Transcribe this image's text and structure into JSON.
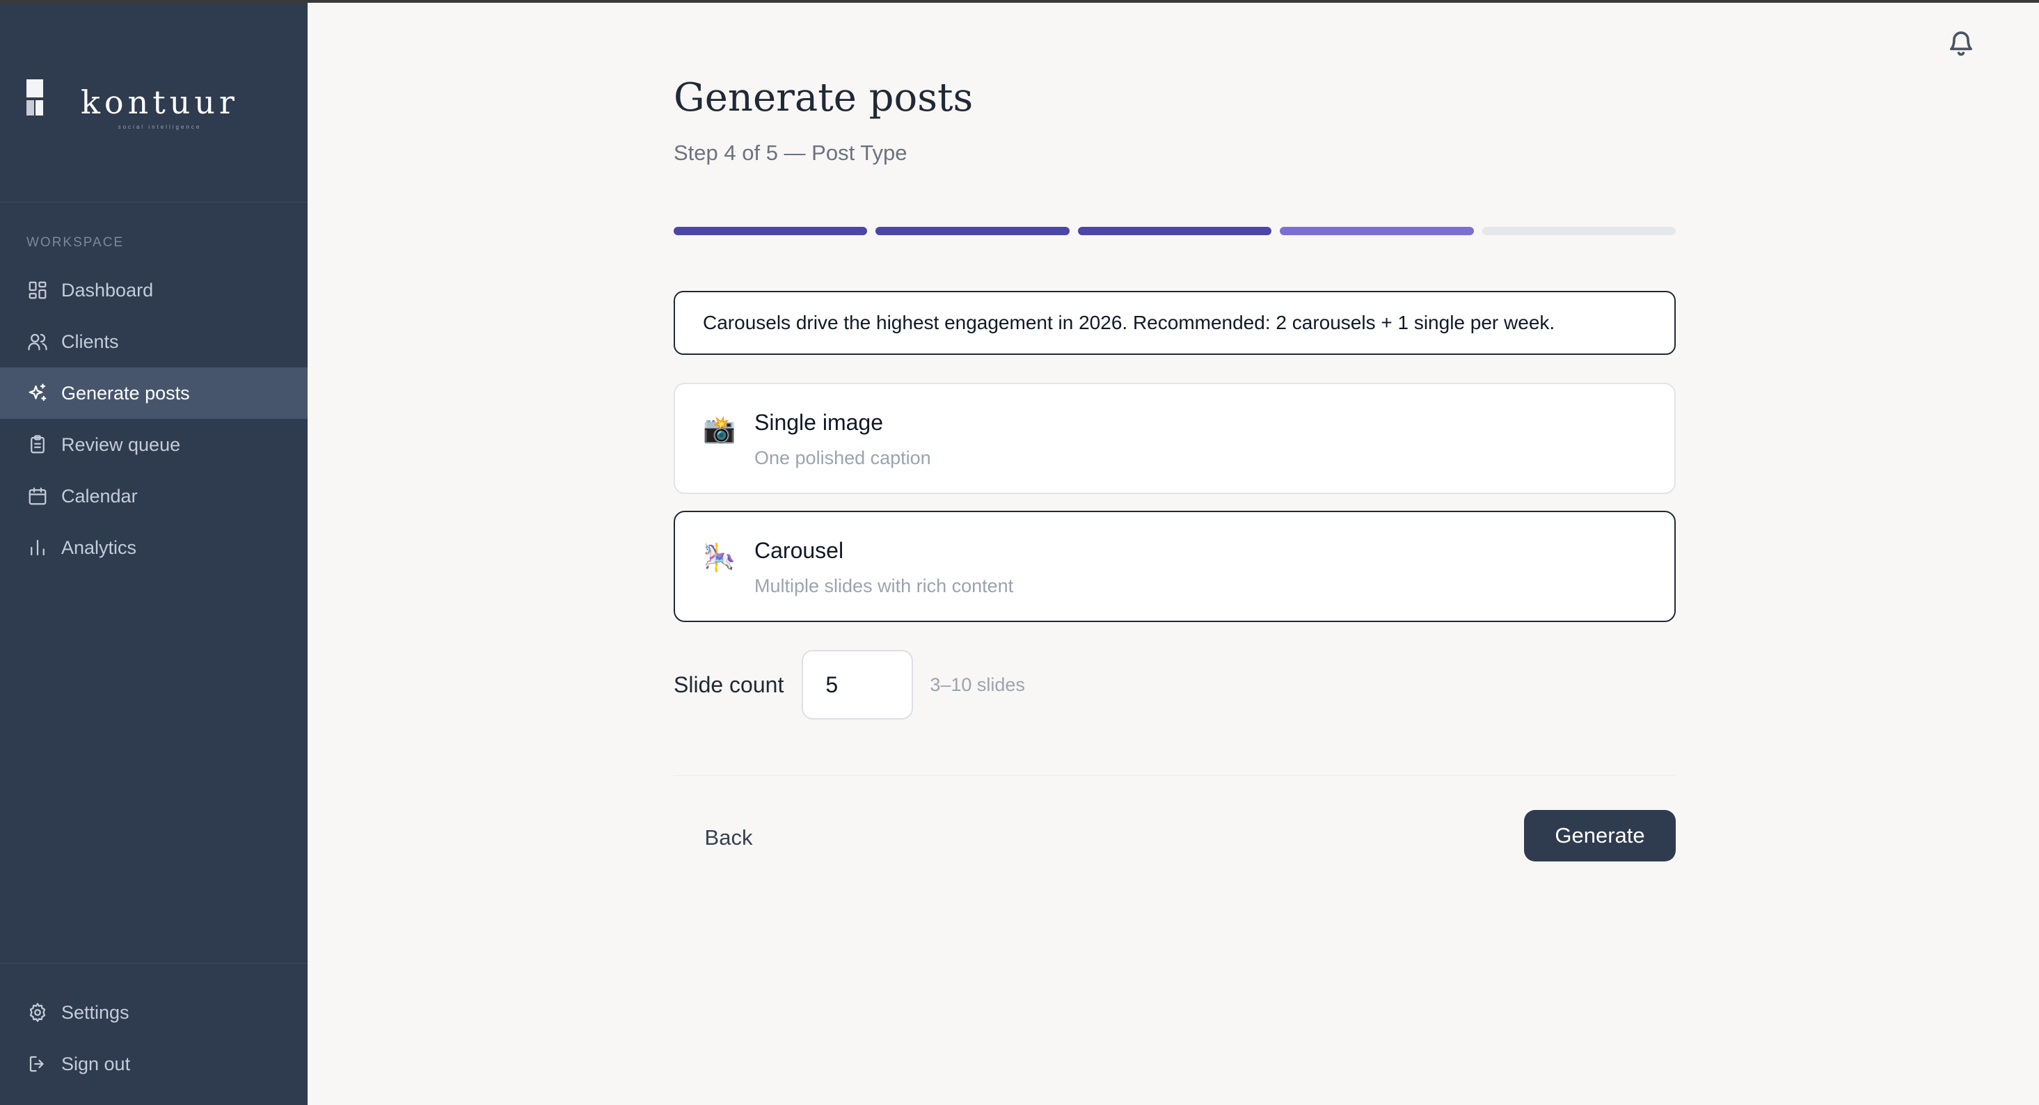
{
  "brand": {
    "name": "kontuur",
    "tagline": "social intelligence"
  },
  "sidebar": {
    "section_label": "WORKSPACE",
    "items": [
      {
        "label": "Dashboard",
        "icon": "dashboard-icon"
      },
      {
        "label": "Clients",
        "icon": "users-icon"
      },
      {
        "label": "Generate posts",
        "icon": "sparkles-icon",
        "active": true
      },
      {
        "label": "Review queue",
        "icon": "clipboard-icon"
      },
      {
        "label": "Calendar",
        "icon": "calendar-icon"
      },
      {
        "label": "Analytics",
        "icon": "bar-chart-icon"
      }
    ],
    "footer_items": [
      {
        "label": "Settings",
        "icon": "gear-icon"
      },
      {
        "label": "Sign out",
        "icon": "sign-out-icon"
      }
    ]
  },
  "header": {
    "notification_icon": "bell-icon"
  },
  "wizard": {
    "title": "Generate posts",
    "subtitle": "Step 4 of 5 — Post Type",
    "current_step": 4,
    "total_steps": 5,
    "tip": "Carousels drive the highest engagement in 2026. Recommended: 2 carousels + 1 single per week.",
    "options": [
      {
        "emoji": "📸",
        "title": "Single image",
        "description": "One polished caption",
        "selected": false
      },
      {
        "emoji": "🎠",
        "title": "Carousel",
        "description": "Multiple slides with rich content",
        "selected": true
      }
    ],
    "slide_count": {
      "label": "Slide count",
      "value": "5",
      "hint": "3–10 slides"
    },
    "back_label": "Back",
    "generate_label": "Generate"
  },
  "colors": {
    "sidebar_bg": "#2f3b4f",
    "sidebar_active": "#46556c",
    "progress_done": "#4a47a8",
    "progress_current": "#7b6fd6",
    "progress_todo": "#e5e7eb",
    "primary_button": "#2f3b4f",
    "page_bg": "#f8f7f5"
  }
}
